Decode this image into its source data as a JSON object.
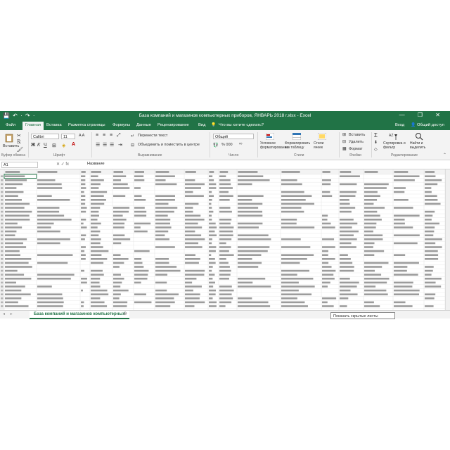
{
  "title_bar": {
    "title": "База компаний и магазинов компьютерных приборов, ЯНВАРЬ 2018 г.xlsx - Excel",
    "quick_access": "💾 ↶ · ↷ ·",
    "window_controls": "— ❐ ✕"
  },
  "ribbon_tabs": [
    "Файл",
    "Главная",
    "Вставка",
    "Разметка страницы",
    "Формулы",
    "Данные",
    "Рецензирование",
    "Вид",
    "Что вы хотите сделать?"
  ],
  "active_tab": "Главная",
  "account": {
    "signin": "Вход",
    "share": "Общий доступ"
  },
  "ribbon": {
    "paste_label": "Вставить",
    "font_name": "Calibri",
    "font_size": "11",
    "font_grow": "A A",
    "bold": "Ж",
    "italic": "К",
    "underline": "Ч",
    "wrap_text": "Перенести текст",
    "merge_center": "Объединить и поместить в центре",
    "number_format": "Общий",
    "percent": "% 000",
    "conditional": "Условное форматирование",
    "format_table": "Форматировать как таблицу",
    "cell_styles": "Стили ячеек",
    "insert": "Вставить",
    "delete": "Удалить",
    "format": "Формат",
    "sum": "Σ",
    "sort_filter": "Сортировка и фильтр",
    "find_select": "Найти и выделить",
    "groups": [
      "Буфер обмена",
      "Шрифт",
      "Выравнивание",
      "Число",
      "Стили",
      "Ячейки",
      "Редактирование"
    ]
  },
  "formula_bar": {
    "name_box": "A1",
    "fx": "✕ ✓ fx",
    "value": "Название"
  },
  "grid": {
    "header_bg": "#f3f3f3",
    "line_color": "#e2e2e2",
    "text_color": "#4a4a4a",
    "visible_rows": 70
  },
  "sheet_tabs": {
    "active": "База компаний и магазинов компьютерных",
    "add": "⊕",
    "nav": "◂ ▸"
  },
  "tooltip": "Показать скрытые листы",
  "colors": {
    "accent": "#217346",
    "ribbon_bg": "#f3f3f3"
  }
}
